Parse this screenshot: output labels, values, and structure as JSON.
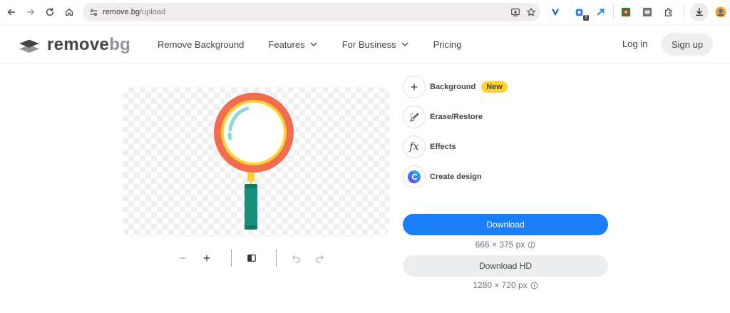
{
  "browser": {
    "url_host": "remove.bg",
    "url_path": "/upload",
    "extension_badge": "5"
  },
  "header": {
    "logo_main": "remove",
    "logo_light": "bg",
    "nav": [
      {
        "label": "Remove Background"
      },
      {
        "label": "Features"
      },
      {
        "label": "For Business"
      },
      {
        "label": "Pricing"
      }
    ],
    "login": "Log in",
    "signup": "Sign up"
  },
  "tools": [
    {
      "label": "Background",
      "badge": "New",
      "icon": "plus-icon"
    },
    {
      "label": "Erase/Restore",
      "icon": "brush-icon"
    },
    {
      "label": "Effects",
      "icon": "fx-icon"
    },
    {
      "label": "Create design",
      "icon": "canva-icon"
    }
  ],
  "download": {
    "label": "Download",
    "size": "666 × 375 px"
  },
  "download_hd": {
    "label": "Download HD",
    "size": "1280 × 720 px"
  },
  "colors": {
    "primary": "#1a7ef9",
    "badge": "#ffd12e",
    "magnifier_ring": "#f26c4f",
    "magnifier_inner_ring": "#ffd12e",
    "magnifier_handle": "#17907a"
  }
}
